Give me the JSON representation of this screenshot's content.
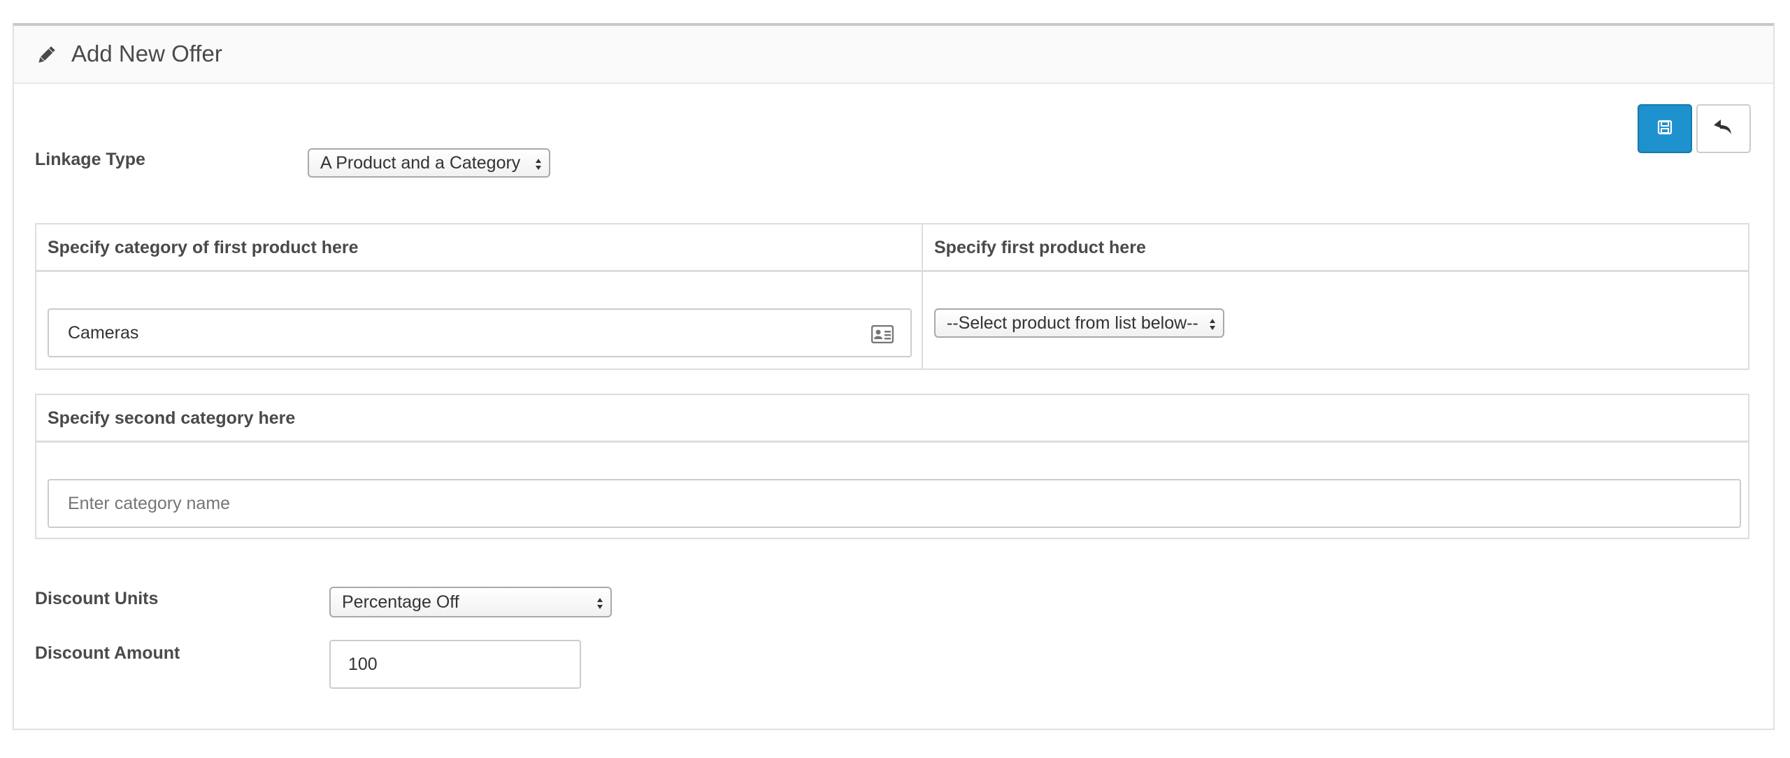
{
  "header": {
    "title": "Add New Offer",
    "icon": "pencil-icon"
  },
  "toolbar": {
    "save_icon": "floppy-disk-icon",
    "back_icon": "reply-arrow-icon",
    "save_color": "#1e91cf"
  },
  "linkage": {
    "label": "Linkage Type",
    "selected": "A Product and a Category"
  },
  "first_section": {
    "category_header": "Specify category of first product here",
    "category_value": "Cameras",
    "category_icon": "id-card-icon",
    "product_header": "Specify first product here",
    "product_selected": "--Select product from list below--"
  },
  "second_section": {
    "header": "Specify second category here",
    "placeholder": "Enter category name"
  },
  "discount": {
    "units_label": "Discount Units",
    "units_selected": "Percentage Off",
    "amount_label": "Discount Amount",
    "amount_value": "100"
  }
}
